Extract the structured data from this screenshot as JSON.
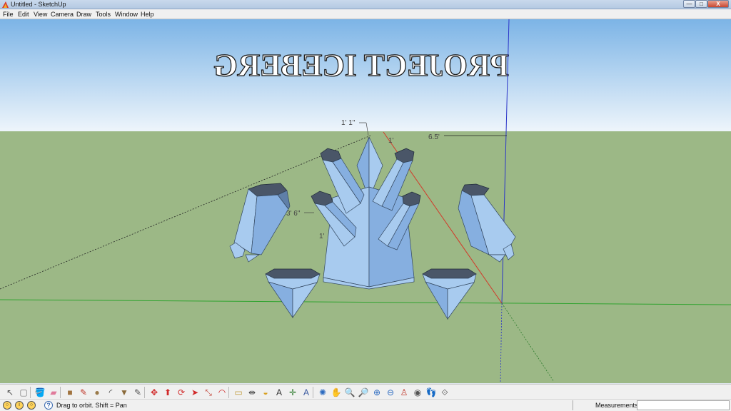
{
  "window": {
    "title": "Untitled - SketchUp",
    "controls": {
      "minimize": "—",
      "maximize": "□",
      "close": "X"
    }
  },
  "menu": [
    "File",
    "Edit",
    "View",
    "Camera",
    "Draw",
    "Tools",
    "Window",
    "Help"
  ],
  "viewport": {
    "banner_text": "PROJECT ICEBERG",
    "dimensions": [
      "1' 1\"",
      "1'",
      "6.5'",
      "3' 6\"",
      "1'"
    ],
    "colors": {
      "sky_top": "#7cb4e6",
      "sky_bottom": "#eef5fb",
      "ground": "#9cb886",
      "ice_light": "#a8cbef",
      "ice_mid": "#86afe0",
      "ice_dark": "#5f7fa8",
      "ice_top": "#4a5668",
      "axis_red": "#d23a2a",
      "axis_green": "#2fa32f",
      "axis_blue": "#2b35c8"
    }
  },
  "toolbar": {
    "tools": [
      {
        "name": "select-icon",
        "glyph": "↖",
        "color": "#555555"
      },
      {
        "name": "make-component-icon",
        "glyph": "▢",
        "color": "#777777"
      },
      {
        "name": "paint-bucket-icon",
        "glyph": "🪣",
        "color": "#2a7bd0"
      },
      {
        "name": "eraser-icon",
        "glyph": "▰",
        "color": "#e07a9a"
      },
      {
        "name": "rectangle-icon",
        "glyph": "■",
        "color": "#a0733f"
      },
      {
        "name": "line-icon",
        "glyph": "✎",
        "color": "#c0392b"
      },
      {
        "name": "circle-icon",
        "glyph": "●",
        "color": "#9a7a4a"
      },
      {
        "name": "arc-icon",
        "glyph": "◜",
        "color": "#444444"
      },
      {
        "name": "polygon-icon",
        "glyph": "▼",
        "color": "#8a6a3a"
      },
      {
        "name": "freehand-icon",
        "glyph": "✎",
        "color": "#555555"
      },
      {
        "name": "move-icon",
        "glyph": "✥",
        "color": "#d12a2a"
      },
      {
        "name": "push-pull-icon",
        "glyph": "⬆",
        "color": "#d12a2a"
      },
      {
        "name": "rotate-icon",
        "glyph": "⟳",
        "color": "#d12a2a"
      },
      {
        "name": "follow-me-icon",
        "glyph": "➤",
        "color": "#d12a2a"
      },
      {
        "name": "scale-icon",
        "glyph": "⤡",
        "color": "#c0392b"
      },
      {
        "name": "offset-icon",
        "glyph": "◠",
        "color": "#d12a2a"
      },
      {
        "name": "tape-measure-icon",
        "glyph": "▭",
        "color": "#c09a3a"
      },
      {
        "name": "dimension-icon",
        "glyph": "⇹",
        "color": "#444444"
      },
      {
        "name": "protractor-icon",
        "glyph": "◒",
        "color": "#d8a020"
      },
      {
        "name": "text-icon",
        "glyph": "A",
        "color": "#333333"
      },
      {
        "name": "axes-icon",
        "glyph": "✛",
        "color": "#2b7a2b"
      },
      {
        "name": "3d-text-icon",
        "glyph": "A",
        "color": "#3a5aa0"
      },
      {
        "name": "orbit-icon",
        "glyph": "✺",
        "color": "#2a6ac0"
      },
      {
        "name": "pan-icon",
        "glyph": "✋",
        "color": "#777777"
      },
      {
        "name": "zoom-icon",
        "glyph": "🔍",
        "color": "#2a6ac0"
      },
      {
        "name": "zoom-window-icon",
        "glyph": "🔎",
        "color": "#2a6ac0"
      },
      {
        "name": "zoom-extents-icon",
        "glyph": "⊕",
        "color": "#2a6ac0"
      },
      {
        "name": "previous-view-icon",
        "glyph": "⊖",
        "color": "#2a6ac0"
      },
      {
        "name": "position-camera-icon",
        "glyph": "♙",
        "color": "#c0392b"
      },
      {
        "name": "look-around-icon",
        "glyph": "◉",
        "color": "#555555"
      },
      {
        "name": "walk-icon",
        "glyph": "👣",
        "color": "#333333"
      },
      {
        "name": "section-plane-icon",
        "glyph": "⟐",
        "color": "#555555"
      }
    ]
  },
  "statusbar": {
    "status_text": "Drag to orbit.  Shift = Pan",
    "help_glyph": "?",
    "measurements_label": "Measurements",
    "measurements_value": ""
  }
}
